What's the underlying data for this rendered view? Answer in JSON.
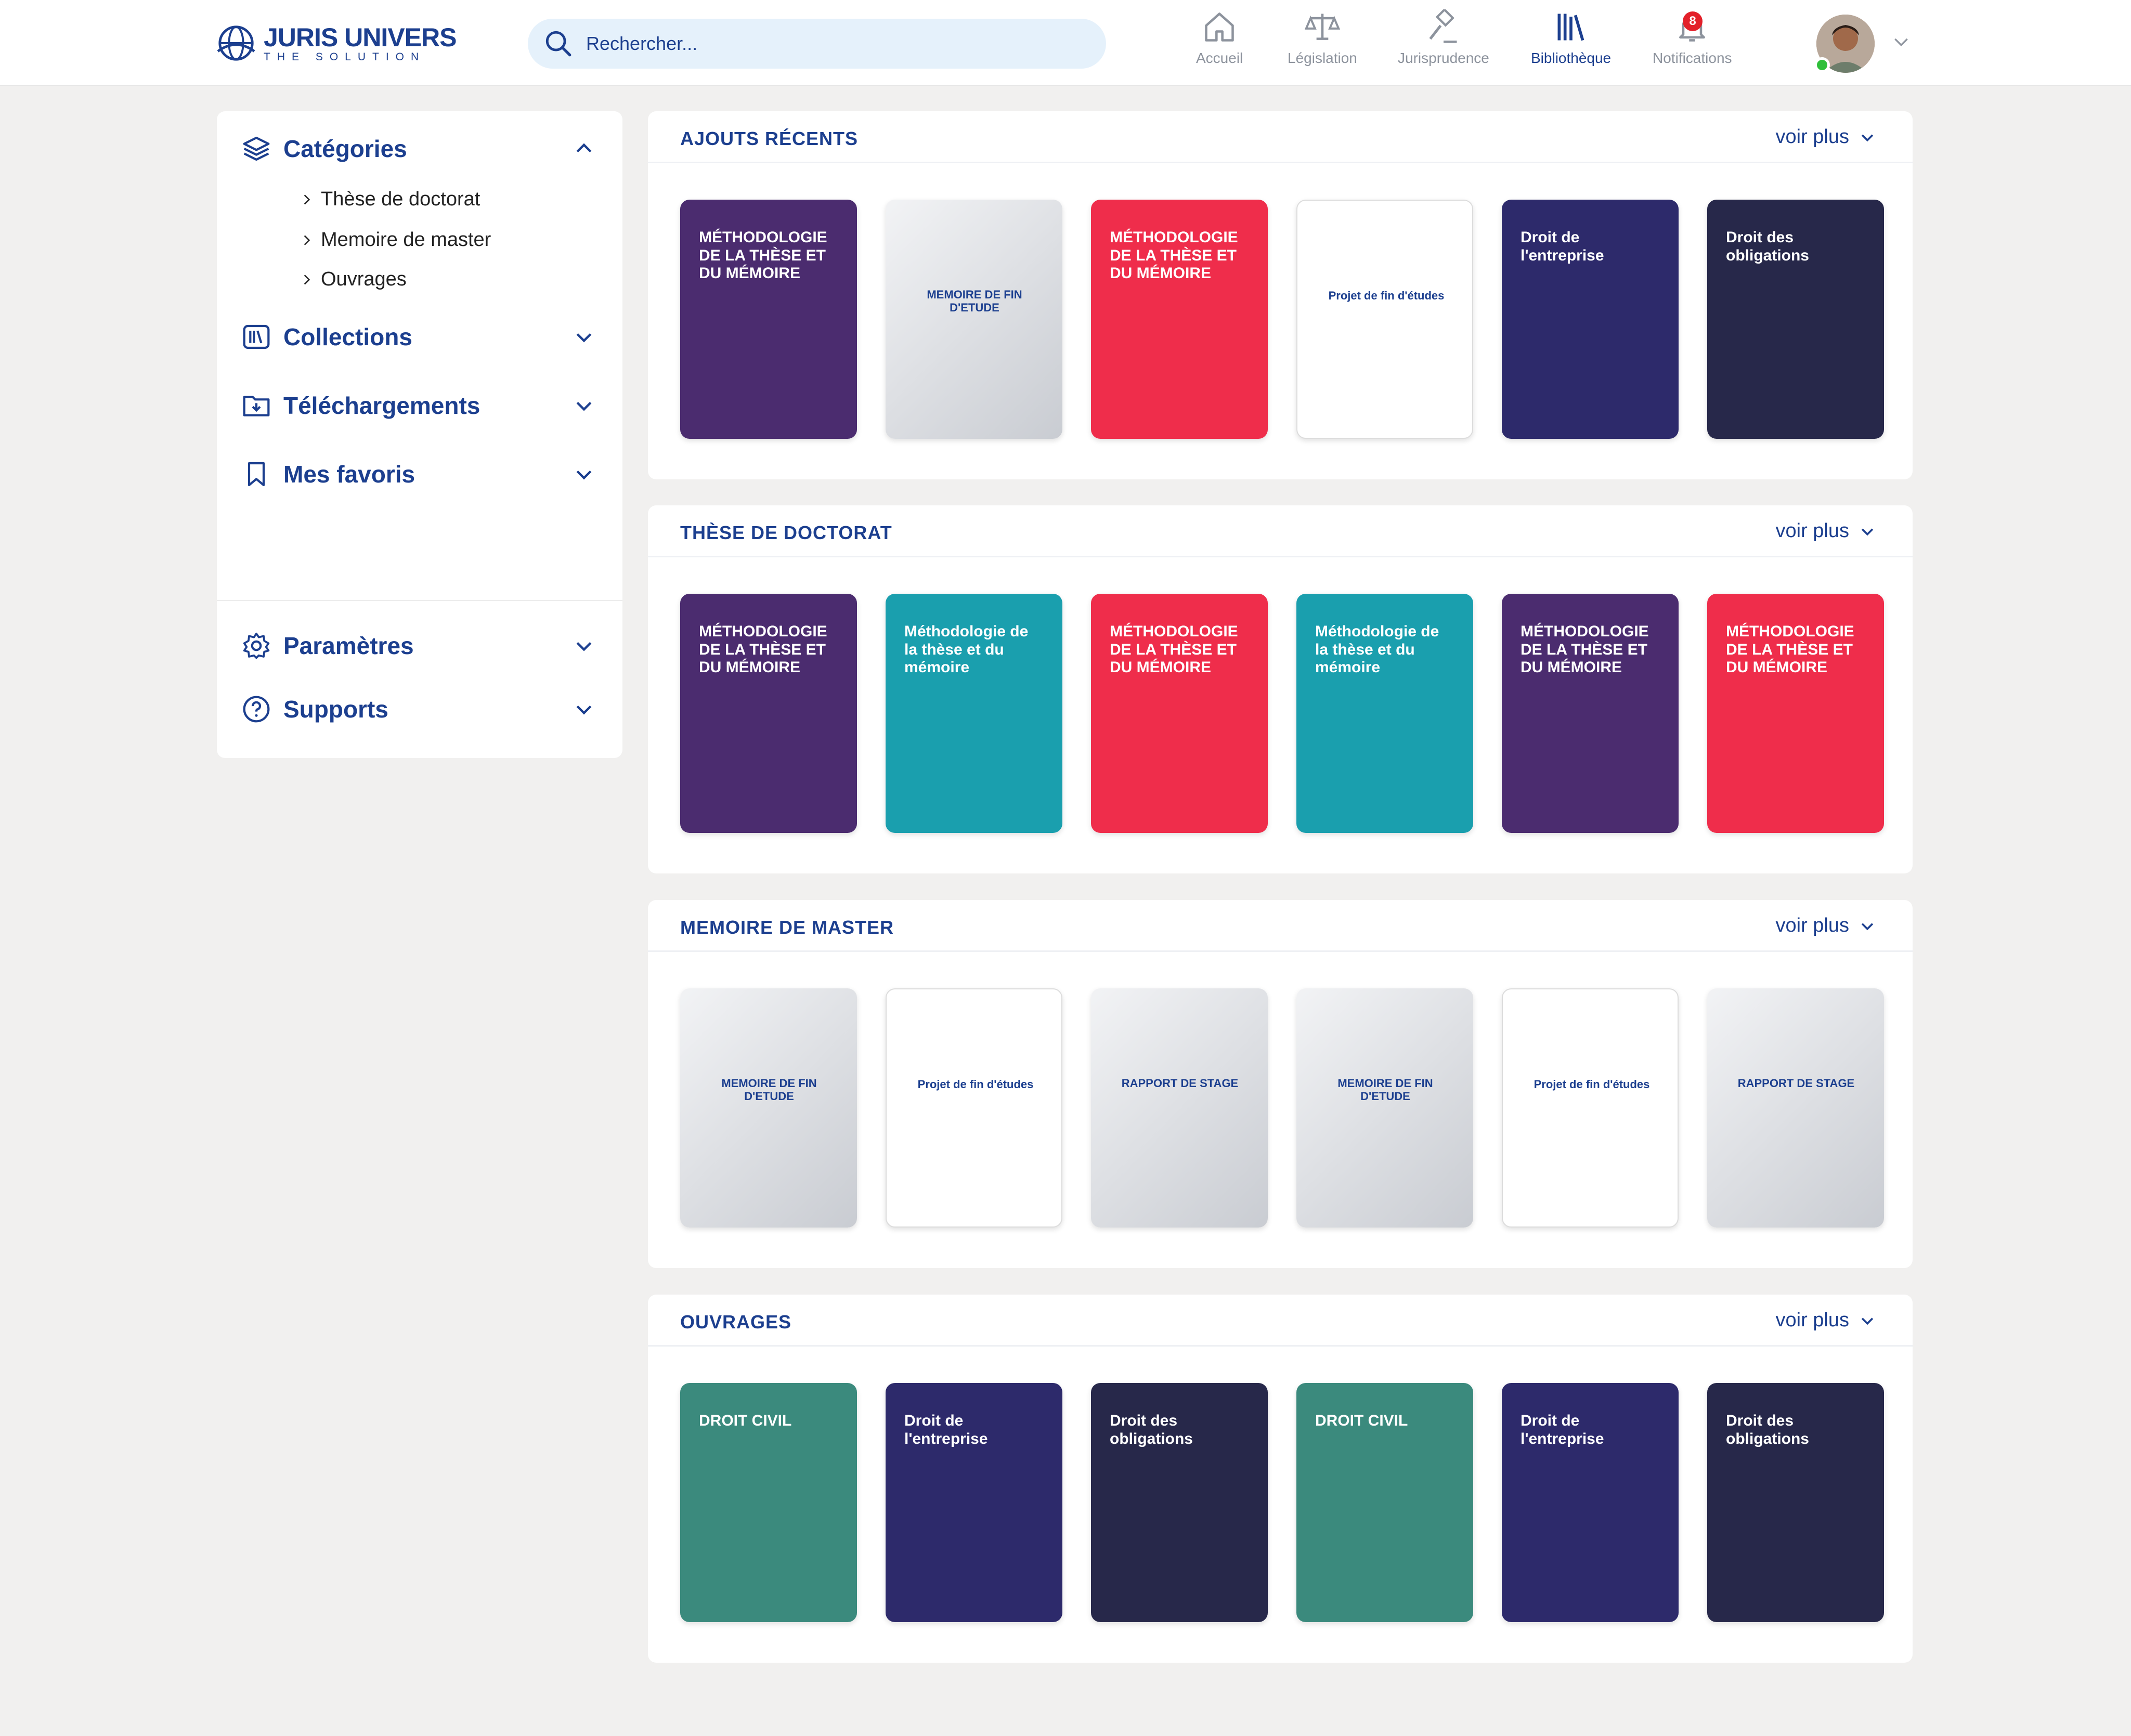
{
  "brand": {
    "name": "JURIS UNIVERS",
    "tagline": "THE SOLUTION"
  },
  "search": {
    "placeholder": "Rechercher..."
  },
  "nav": [
    {
      "label": "Accueil",
      "icon": "home-icon",
      "active": false
    },
    {
      "label": "Législation",
      "icon": "scales-icon",
      "active": false
    },
    {
      "label": "Jurisprudence",
      "icon": "gavel-icon",
      "active": false
    },
    {
      "label": "Bibliothèque",
      "icon": "library-icon",
      "active": true
    },
    {
      "label": "Notifications",
      "icon": "bell-icon",
      "active": false,
      "badge": "8"
    }
  ],
  "user": {
    "avatar": "user-avatar",
    "online": true
  },
  "sidebar": {
    "categories": {
      "label": "Catégories",
      "expanded": true,
      "items": [
        "Thèse de doctorat",
        "Memoire de master",
        "Ouvrages"
      ]
    },
    "collections": {
      "label": "Collections"
    },
    "downloads": {
      "label": "Téléchargements"
    },
    "favorites": {
      "label": "Mes favoris"
    },
    "settings": {
      "label": "Paramètres"
    },
    "supports": {
      "label": "Supports"
    }
  },
  "sections": [
    {
      "title": "AJOUTS RÉCENTS",
      "more": "voir plus",
      "books": [
        {
          "style": "b-purple",
          "title": "MÉTHODOLOGIE DE LA THÈSE ET DU MÉMOIRE"
        },
        {
          "style": "b-grey",
          "title": "MEMOIRE DE FIN D'ETUDE"
        },
        {
          "style": "b-red",
          "title": "MÉTHODOLOGIE DE LA THÈSE ET DU MÉMOIRE"
        },
        {
          "style": "b-white",
          "title": "Projet de fin d'études"
        },
        {
          "style": "b-navy",
          "title": "Droit de l'entreprise"
        },
        {
          "style": "b-dark",
          "title": "Droit des obligations"
        }
      ]
    },
    {
      "title": "THÈSE DE DOCTORAT",
      "more": "voir plus",
      "books": [
        {
          "style": "b-purple",
          "title": "MÉTHODOLOGIE DE LA THÈSE ET DU MÉMOIRE"
        },
        {
          "style": "b-teal",
          "title": "Méthodologie de la thèse et du mémoire"
        },
        {
          "style": "b-red",
          "title": "MÉTHODOLOGIE DE LA THÈSE ET DU MÉMOIRE"
        },
        {
          "style": "b-teal",
          "title": "Méthodologie de la thèse et du mémoire"
        },
        {
          "style": "b-purple",
          "title": "MÉTHODOLOGIE DE LA THÈSE ET DU MÉMOIRE"
        },
        {
          "style": "b-red",
          "title": "MÉTHODOLOGIE DE LA THÈSE ET DU MÉMOIRE"
        }
      ]
    },
    {
      "title": "MEMOIRE DE MASTER",
      "more": "voir plus",
      "books": [
        {
          "style": "b-grey",
          "title": "MEMOIRE DE FIN D'ETUDE"
        },
        {
          "style": "b-white",
          "title": "Projet de fin d'études"
        },
        {
          "style": "b-grey",
          "title": "RAPPORT DE STAGE"
        },
        {
          "style": "b-grey",
          "title": "MEMOIRE DE FIN D'ETUDE"
        },
        {
          "style": "b-white",
          "title": "Projet de fin d'études"
        },
        {
          "style": "b-grey",
          "title": "RAPPORT DE STAGE"
        }
      ]
    },
    {
      "title": "OUVRAGES",
      "more": "voir plus",
      "books": [
        {
          "style": "b-green",
          "title": "DROIT CIVIL"
        },
        {
          "style": "b-navy",
          "title": "Droit de l'entreprise"
        },
        {
          "style": "b-dark",
          "title": "Droit des obligations"
        },
        {
          "style": "b-green",
          "title": "DROIT CIVIL"
        },
        {
          "style": "b-navy",
          "title": "Droit de l'entreprise"
        },
        {
          "style": "b-dark",
          "title": "Droit des obligations"
        }
      ]
    }
  ],
  "colors": {
    "primary": "#1c3f8f",
    "background": "#f1f0ef",
    "badge": "#e3202a",
    "online": "#2fbf3a"
  }
}
